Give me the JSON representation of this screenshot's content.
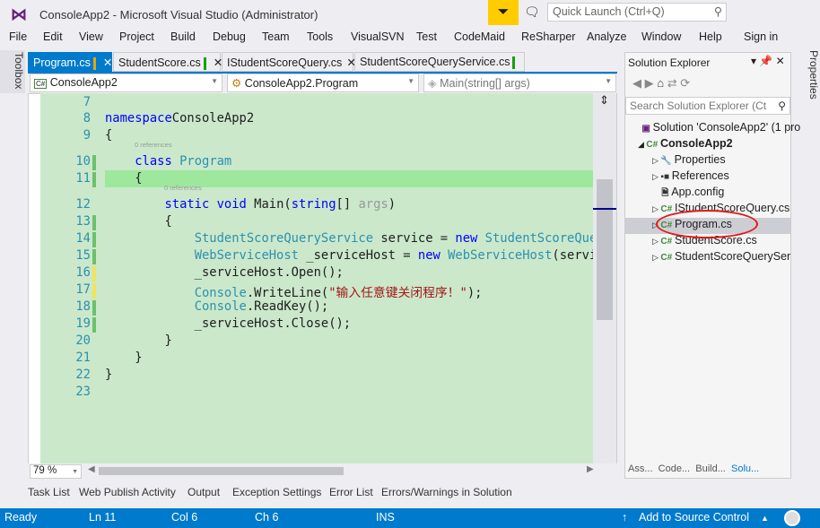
{
  "window": {
    "title": "ConsoleApp2 - Microsoft Visual Studio (Administrator)",
    "quick_launch_placeholder": "Quick Launch (Ctrl+Q)"
  },
  "menu": [
    "File",
    "Edit",
    "View",
    "Project",
    "Build",
    "Debug",
    "Team",
    "Tools",
    "VisualSVN",
    "Test",
    "CodeMaid",
    "ReSharper",
    "Analyze",
    "Window",
    "Help"
  ],
  "sign_in": "Sign in",
  "side": {
    "toolbox": "Toolbox",
    "properties": "Properties"
  },
  "tabs": [
    {
      "label": "Program.cs",
      "active": true,
      "mark": "#e5a800"
    },
    {
      "label": "StudentScore.cs",
      "mark": "#13a10e"
    },
    {
      "label": "IStudentScoreQuery.cs"
    },
    {
      "label": "StudentScoreQueryService.cs",
      "mark": "#13a10e"
    }
  ],
  "nav": {
    "project": "ConsoleApp2",
    "class": "ConsoleApp2.Program",
    "member": "Main(string[] args)"
  },
  "code": [
    {
      "n": 7,
      "t": []
    },
    {
      "n": 8,
      "t": [
        [
          "kw",
          "namespace"
        ],
        [
          "",
          "ConsoleApp2"
        ]
      ]
    },
    {
      "n": 9,
      "t": [
        [
          "",
          "{"
        ]
      ]
    },
    {
      "n": 10,
      "lens": "0 references",
      "t": [
        [
          "",
          "    "
        ],
        [
          "kw",
          "class"
        ],
        [
          "",
          " "
        ],
        [
          "ty",
          "Program"
        ]
      ],
      "chg": "#6cc16c"
    },
    {
      "n": 11,
      "t": [
        [
          "",
          "    {"
        ]
      ],
      "chg": "#6cc16c"
    },
    {
      "n": 12,
      "lens": "0 references",
      "t": [
        [
          "",
          "        "
        ],
        [
          "kw",
          "static"
        ],
        [
          "",
          " "
        ],
        [
          "kw",
          "void"
        ],
        [
          "",
          " Main("
        ],
        [
          "kw",
          "string"
        ],
        [
          "",
          "[] "
        ],
        [
          "cm",
          "args"
        ],
        [
          "",
          ")"
        ]
      ]
    },
    {
      "n": 13,
      "t": [
        [
          "",
          "        {"
        ]
      ],
      "chg": "#6cc16c"
    },
    {
      "n": 14,
      "t": [
        [
          "",
          "            "
        ],
        [
          "ty",
          "StudentScoreQueryService"
        ],
        [
          "",
          " service = "
        ],
        [
          "kw",
          "new"
        ],
        [
          "",
          " "
        ],
        [
          "ty",
          "StudentScoreQue"
        ]
      ],
      "chg": "#6cc16c"
    },
    {
      "n": 15,
      "t": [
        [
          "",
          "            "
        ],
        [
          "ty",
          "WebServiceHost"
        ],
        [
          "",
          " _serviceHost = "
        ],
        [
          "kw",
          "new"
        ],
        [
          "",
          " "
        ],
        [
          "ty",
          "WebServiceHost"
        ],
        [
          "",
          "(servi"
        ]
      ],
      "chg": "#6cc16c"
    },
    {
      "n": 16,
      "t": [
        [
          "",
          "            _serviceHost.Open();"
        ]
      ],
      "chg": "#f2e35a"
    },
    {
      "n": 17,
      "t": [
        [
          "",
          "            "
        ],
        [
          "ty",
          "Console"
        ],
        [
          "",
          ".WriteLine("
        ],
        [
          "str",
          "\"输入任意键关闭程序！\""
        ],
        [
          "",
          ");"
        ]
      ],
      "chg": "#f2e35a"
    },
    {
      "n": 18,
      "t": [
        [
          "",
          "            "
        ],
        [
          "ty",
          "Console"
        ],
        [
          "",
          ".ReadKey();"
        ]
      ],
      "chg": "#6cc16c"
    },
    {
      "n": 19,
      "t": [
        [
          "",
          "            _serviceHost.Close();"
        ]
      ],
      "chg": "#6cc16c"
    },
    {
      "n": 20,
      "t": [
        [
          "",
          "        }"
        ]
      ]
    },
    {
      "n": 21,
      "t": [
        [
          "",
          "    }"
        ]
      ]
    },
    {
      "n": 22,
      "t": [
        [
          "",
          "}"
        ]
      ]
    },
    {
      "n": 23,
      "t": []
    }
  ],
  "zoom": "79 %",
  "solution_explorer": {
    "title": "Solution Explorer",
    "search_placeholder": "Search Solution Explorer (Ct",
    "items": [
      {
        "label": "Solution 'ConsoleApp2' (1 pro",
        "icon": "solution-icon"
      },
      {
        "label": "ConsoleApp2",
        "icon": "csharp-project-icon",
        "bold": true
      },
      {
        "label": "Properties",
        "icon": "wrench-icon"
      },
      {
        "label": "References",
        "icon": "references-icon"
      },
      {
        "label": "App.config",
        "icon": "config-icon"
      },
      {
        "label": "IStudentScoreQuery.cs",
        "icon": "csharp-file-icon"
      },
      {
        "label": "Program.cs",
        "icon": "csharp-file-icon",
        "selected": true
      },
      {
        "label": "StudentScore.cs",
        "icon": "csharp-file-icon"
      },
      {
        "label": "StudentScoreQuerySer",
        "icon": "csharp-file-icon"
      }
    ],
    "bottom_tabs": [
      "Ass...",
      "Code...",
      "Build...",
      "Solu..."
    ]
  },
  "bottom_tabs": [
    "Task List",
    "Web Publish Activity",
    "Output",
    "Exception Settings",
    "Error List",
    "Errors/Warnings in Solution"
  ],
  "status": {
    "ready": "Ready",
    "ln": "Ln 11",
    "col": "Col 6",
    "ch": "Ch 6",
    "ins": "INS",
    "source_control": "Add to Source Control"
  },
  "colors": {
    "accent": "#007acc",
    "editor_bg": "#cbe8cb",
    "highlight": "#9de89d",
    "annotation": "#e01a1a"
  }
}
